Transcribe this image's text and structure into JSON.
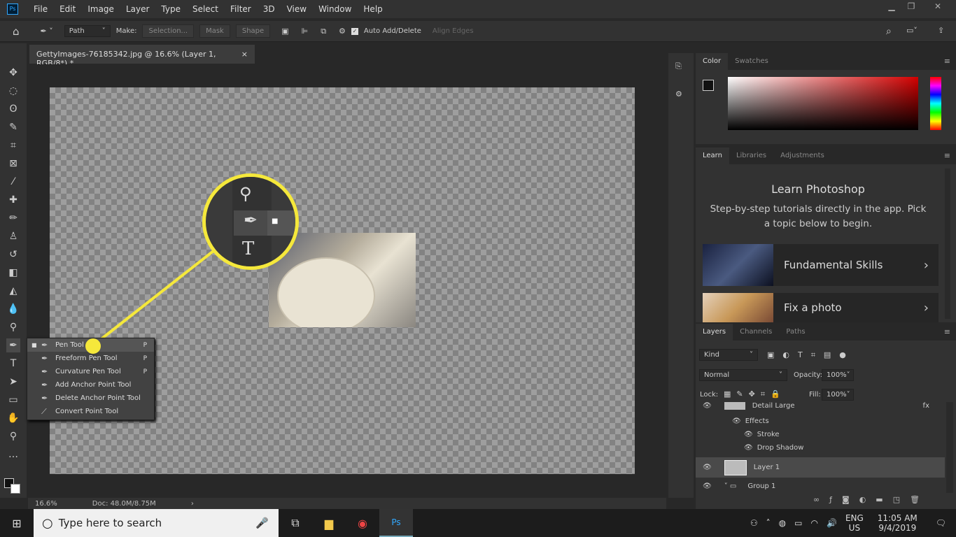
{
  "app": {
    "logo": "Ps",
    "menu": [
      "File",
      "Edit",
      "Image",
      "Layer",
      "Type",
      "Select",
      "Filter",
      "3D",
      "View",
      "Window",
      "Help"
    ]
  },
  "options": {
    "mode": "Path",
    "make_label": "Make:",
    "selection": "Selection...",
    "mask": "Mask",
    "shape": "Shape",
    "auto_add_delete": "Auto Add/Delete",
    "auto_add_checked": true,
    "align_edges": "Align Edges"
  },
  "document": {
    "tab_title": "GettyImages-76185342.jpg @ 16.6% (Layer 1, RGB/8*) *",
    "close": "×",
    "zoom": "16.6%",
    "doc_size": "Doc: 48.0M/8.75M"
  },
  "flyout": [
    {
      "label": "Pen Tool",
      "shortcut": "P",
      "active": true,
      "icon": "pen-icon"
    },
    {
      "label": "Freeform Pen Tool",
      "shortcut": "P",
      "icon": "freeform-pen-icon"
    },
    {
      "label": "Curvature Pen Tool",
      "shortcut": "P",
      "icon": "curvature-pen-icon"
    },
    {
      "label": "Add Anchor Point Tool",
      "shortcut": "",
      "icon": "add-anchor-icon"
    },
    {
      "label": "Delete Anchor Point Tool",
      "shortcut": "",
      "icon": "delete-anchor-icon"
    },
    {
      "label": "Convert Point Tool",
      "shortcut": "",
      "icon": "convert-point-icon"
    }
  ],
  "callout_color": "#f5e83b",
  "color_panel": {
    "tabs": [
      "Color",
      "Swatches"
    ],
    "hue_color": "#d40000"
  },
  "learn_panel": {
    "tabs": [
      "Learn",
      "Libraries",
      "Adjustments"
    ],
    "title": "Learn Photoshop",
    "subtitle": "Step-by-step tutorials directly in the app. Pick a topic below to begin.",
    "cards": [
      "Fundamental Skills",
      "Fix a photo"
    ]
  },
  "layers_panel": {
    "tabs": [
      "Layers",
      "Channels",
      "Paths"
    ],
    "filter": "Kind",
    "blend_mode": "Normal",
    "opacity_label": "Opacity:",
    "opacity": "100%",
    "lock_label": "Lock:",
    "fill_label": "Fill:",
    "fill": "100%",
    "layers": [
      {
        "name": "Detail Large",
        "fx": "fx"
      },
      {
        "name": "Effects"
      },
      {
        "name": "Stroke"
      },
      {
        "name": "Drop Shadow"
      },
      {
        "name": "Layer 1",
        "selected": true
      },
      {
        "name": "Group 1"
      }
    ]
  },
  "taskbar": {
    "search_placeholder": "Type here to search",
    "lang1": "ENG",
    "lang2": "US",
    "time": "11:05 AM",
    "date": "9/4/2019"
  }
}
